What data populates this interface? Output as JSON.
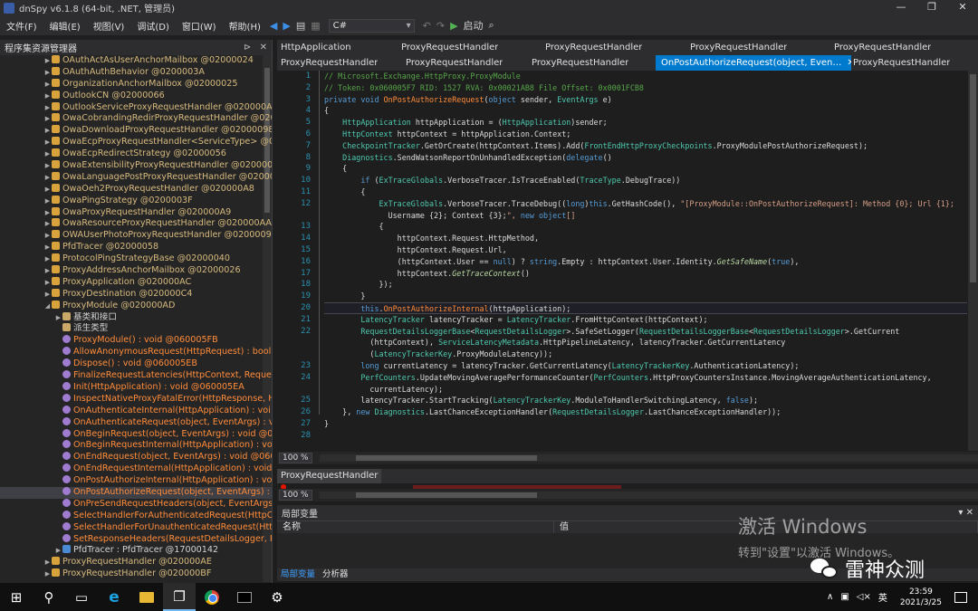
{
  "window": {
    "title": "dnSpy v6.1.8 (64-bit, .NET, 管理员)",
    "min": "—",
    "max": "❐",
    "close": "✕"
  },
  "menu": [
    "文件(F)",
    "编辑(E)",
    "视图(V)",
    "调试(D)",
    "窗口(W)",
    "帮助(H)"
  ],
  "toolbar": {
    "language": "C#",
    "start_label": "启动"
  },
  "sidebar": {
    "title": "程序集资源管理器",
    "items": [
      {
        "kind": "cls",
        "exp": "▶",
        "indent": 4,
        "text": "OAuthActAsUserAnchorMailbox @02000024"
      },
      {
        "kind": "cls",
        "exp": "▶",
        "indent": 4,
        "text": "OAuthAuthBehavior @0200003A"
      },
      {
        "kind": "cls",
        "exp": "▶",
        "indent": 4,
        "text": "OrganizationAnchorMailbox @02000025"
      },
      {
        "kind": "cls",
        "exp": "▶",
        "indent": 4,
        "text": "OutlookCN @02000066"
      },
      {
        "kind": "cls",
        "exp": "▶",
        "indent": 4,
        "text": "OutlookServiceProxyRequestHandler @020000A0"
      },
      {
        "kind": "cls",
        "exp": "▶",
        "indent": 4,
        "text": "OwaCobrandingRedirProxyRequestHandler @020000A1"
      },
      {
        "kind": "cls",
        "exp": "▶",
        "indent": 4,
        "text": "OwaDownloadProxyRequestHandler @02000098"
      },
      {
        "kind": "cls",
        "exp": "▶",
        "indent": 4,
        "text": "OwaEcpProxyRequestHandler<ServiceType> @02"
      },
      {
        "kind": "cls",
        "exp": "▶",
        "indent": 4,
        "text": "OwaEcpRedirectStrategy @02000056"
      },
      {
        "kind": "cls",
        "exp": "▶",
        "indent": 4,
        "text": "OwaExtensibilityProxyRequestHandler @020000A"
      },
      {
        "kind": "cls",
        "exp": "▶",
        "indent": 4,
        "text": "OwaLanguagePostProxyRequestHandler @02000"
      },
      {
        "kind": "cls",
        "exp": "▶",
        "indent": 4,
        "text": "OwaOeh2ProxyRequestHandler @020000A8"
      },
      {
        "kind": "cls",
        "exp": "▶",
        "indent": 4,
        "text": "OwaPingStrategy @0200003F"
      },
      {
        "kind": "cls",
        "exp": "▶",
        "indent": 4,
        "text": "OwaProxyRequestHandler @020000A9"
      },
      {
        "kind": "cls",
        "exp": "▶",
        "indent": 4,
        "text": "OwaResourceProxyRequestHandler @020000AA"
      },
      {
        "kind": "cls",
        "exp": "▶",
        "indent": 4,
        "text": "OWAUserPhotoProxyRequestHandler @02000099"
      },
      {
        "kind": "cls",
        "exp": "▶",
        "indent": 4,
        "text": "PfdTracer @02000058"
      },
      {
        "kind": "cls",
        "exp": "▶",
        "indent": 4,
        "text": "ProtocolPingStrategyBase @02000040"
      },
      {
        "kind": "cls",
        "exp": "▶",
        "indent": 4,
        "text": "ProxyAddressAnchorMailbox @02000026"
      },
      {
        "kind": "cls",
        "exp": "▶",
        "indent": 4,
        "text": "ProxyApplication @020000AC"
      },
      {
        "kind": "cls",
        "exp": "▶",
        "indent": 4,
        "text": "ProxyDestination @020000C4"
      },
      {
        "kind": "mod",
        "exp": "◢",
        "indent": 4,
        "text": "ProxyModule @020000AD"
      },
      {
        "kind": "folder",
        "exp": "▶",
        "indent": 5,
        "text": "基类和接口",
        "style": "plain"
      },
      {
        "kind": "folder",
        "exp": "",
        "indent": 5,
        "text": "派生类型",
        "style": "plain"
      },
      {
        "kind": "meth",
        "exp": "",
        "indent": 5,
        "text": "ProxyModule() : void @060005FB",
        "style": "method"
      },
      {
        "kind": "meth",
        "exp": "",
        "indent": 5,
        "text": "AllowAnonymousRequest(HttpRequest) : bool",
        "style": "method"
      },
      {
        "kind": "meth",
        "exp": "",
        "indent": 5,
        "text": "Dispose() : void @060005EB",
        "style": "method"
      },
      {
        "kind": "meth",
        "exp": "",
        "indent": 5,
        "text": "FinalizeRequestLatencies(HttpContext, Request",
        "style": "method"
      },
      {
        "kind": "meth",
        "exp": "",
        "indent": 5,
        "text": "Init(HttpApplication) : void @060005EA",
        "style": "method"
      },
      {
        "kind": "meth",
        "exp": "",
        "indent": 5,
        "text": "InspectNativeProxyFatalError(HttpResponse, Ht",
        "style": "method"
      },
      {
        "kind": "meth",
        "exp": "",
        "indent": 5,
        "text": "OnAuthenticateInternal(HttpApplication) : voi",
        "style": "method"
      },
      {
        "kind": "meth",
        "exp": "",
        "indent": 5,
        "text": "OnAuthenticateRequest(object, EventArgs) : vo",
        "style": "method"
      },
      {
        "kind": "meth",
        "exp": "",
        "indent": 5,
        "text": "OnBeginRequest(object, EventArgs) : void @06",
        "style": "method"
      },
      {
        "kind": "meth",
        "exp": "",
        "indent": 5,
        "text": "OnBeginRequestInternal(HttpApplication) : voi",
        "style": "method"
      },
      {
        "kind": "meth",
        "exp": "",
        "indent": 5,
        "text": "OnEndRequest(object, EventArgs) : void @0600",
        "style": "method"
      },
      {
        "kind": "meth",
        "exp": "",
        "indent": 5,
        "text": "OnEndRequestInternal(HttpApplication) : void",
        "style": "method"
      },
      {
        "kind": "meth",
        "exp": "",
        "indent": 5,
        "text": "OnPostAuthorizeInternal(HttpApplication) : vo",
        "style": "method"
      },
      {
        "kind": "meth",
        "exp": "",
        "indent": 5,
        "text": "OnPostAuthorizeRequest(object, EventArgs) : v",
        "style": "method",
        "sel": true
      },
      {
        "kind": "meth",
        "exp": "",
        "indent": 5,
        "text": "OnPreSendRequestHeaders(object, EventArgs)",
        "style": "method"
      },
      {
        "kind": "meth",
        "exp": "",
        "indent": 5,
        "text": "SelectHandlerForAuthenticatedRequest(HttpCo",
        "style": "method"
      },
      {
        "kind": "meth",
        "exp": "",
        "indent": 5,
        "text": "SelectHandlerForUnauthenticatedRequest(Http",
        "style": "method"
      },
      {
        "kind": "meth",
        "exp": "",
        "indent": 5,
        "text": "SetResponseHeaders(RequestDetailsLogger, Ht",
        "style": "method"
      },
      {
        "kind": "field",
        "exp": "▶",
        "indent": 5,
        "text": "PfdTracer : PfdTracer @17000142",
        "style": "plain"
      },
      {
        "kind": "cls",
        "exp": "▶",
        "indent": 4,
        "text": "ProxyRequestHandler @020000AE"
      },
      {
        "kind": "cls",
        "exp": "▶",
        "indent": 4,
        "text": "ProxyRequestHandler @020000BF"
      }
    ]
  },
  "tabs_row1": [
    "HttpApplication",
    "ProxyRequestHandler",
    "ProxyRequestHandler",
    "ProxyRequestHandler",
    "ProxyRequestHandler"
  ],
  "tabs_row2": [
    "ProxyRequestHandler",
    "ProxyRequestHandler",
    "ProxyRequestHandler",
    "OnPostAuthorizeRequest(object, Even…",
    "ProxyRequestHandler"
  ],
  "active_tab_close": "✕",
  "editor": {
    "line_numbers": [
      "1",
      "2",
      "3",
      "4",
      "5",
      "6",
      "7",
      "8",
      "9",
      "10",
      "11",
      "12",
      "",
      "13",
      "14",
      "15",
      "16",
      "17",
      "18",
      "19",
      "20",
      "21",
      "22",
      "",
      "",
      "23",
      "24",
      "",
      "25",
      "26",
      "27",
      "28"
    ],
    "code": [
      "// Microsoft.Exchange.HttpProxy.ProxyModule",
      "// Token: 0x060005F7 RID: 1527 RVA: 0x00021AB8 File Offset: 0x0001FCB8",
      "private void OnPostAuthorizeRequest(object sender, EventArgs e)",
      "{",
      "    HttpApplication httpApplication = (HttpApplication)sender;",
      "    HttpContext httpContext = httpApplication.Context;",
      "    CheckpointTracker.GetOrCreate(httpContext.Items).Add(FrontEndHttpProxyCheckpoints.ProxyModulePostAuthorizeRequest);",
      "    Diagnostics.SendWatsonReportOnUnhandledException(delegate()",
      "    {",
      "        if (ExTraceGlobals.VerboseTracer.IsTraceEnabled(TraceType.DebugTrace))",
      "        {",
      "            ExTraceGlobals.VerboseTracer.TraceDebug((long)this.GetHashCode(), \"[ProxyModule::OnPostAuthorizeRequest]: Method {0}; Url {1};",
      "              Username {2}; Context {3};\", new object[]",
      "            {",
      "                httpContext.Request.HttpMethod,",
      "                httpContext.Request.Url,",
      "                (httpContext.User == null) ? string.Empty : httpContext.User.Identity.GetSafeName(true),",
      "                httpContext.GetTraceContext()",
      "            });",
      "        }",
      "        this.OnPostAuthorizeInternal(httpApplication);",
      "        LatencyTracker latencyTracker = LatencyTracker.FromHttpContext(httpContext);",
      "        RequestDetailsLoggerBase<RequestDetailsLogger>.SafeSetLogger(RequestDetailsLoggerBase<RequestDetailsLogger>.GetCurrent",
      "          (httpContext), ServiceLatencyMetadata.HttpPipelineLatency, latencyTracker.GetCurrentLatency",
      "          (LatencyTrackerKey.ProxyModuleLatency));",
      "        long currentLatency = latencyTracker.GetCurrentLatency(LatencyTrackerKey.AuthenticationLatency);",
      "        PerfCounters.UpdateMovingAveragePerformanceCounter(PerfCounters.HttpProxyCountersInstance.MovingAverageAuthenticationLatency,",
      "          currentLatency);",
      "        latencyTracker.StartTracking(LatencyTrackerKey.ModuleToHandlerSwitchingLatency, false);",
      "    }, new Diagnostics.LastChanceExceptionHandler(RequestDetailsLogger.LastChanceExceptionHandler));",
      "}",
      ""
    ]
  },
  "zoom": "100 %",
  "bottom_tab": "ProxyRequestHandler",
  "zoom2": "100 %",
  "locals": {
    "title": "局部变量",
    "col_name": "名称",
    "col_value": "值"
  },
  "bottom_tabs": [
    "局部变量",
    "分析器"
  ],
  "watermark": {
    "line1": "激活 Windows",
    "line2": "转到\"设置\"以激活 Windows。"
  },
  "brand": "雷神众测",
  "taskbar": {
    "ime": "英",
    "time": "23:59",
    "date": "2021/3/25"
  }
}
